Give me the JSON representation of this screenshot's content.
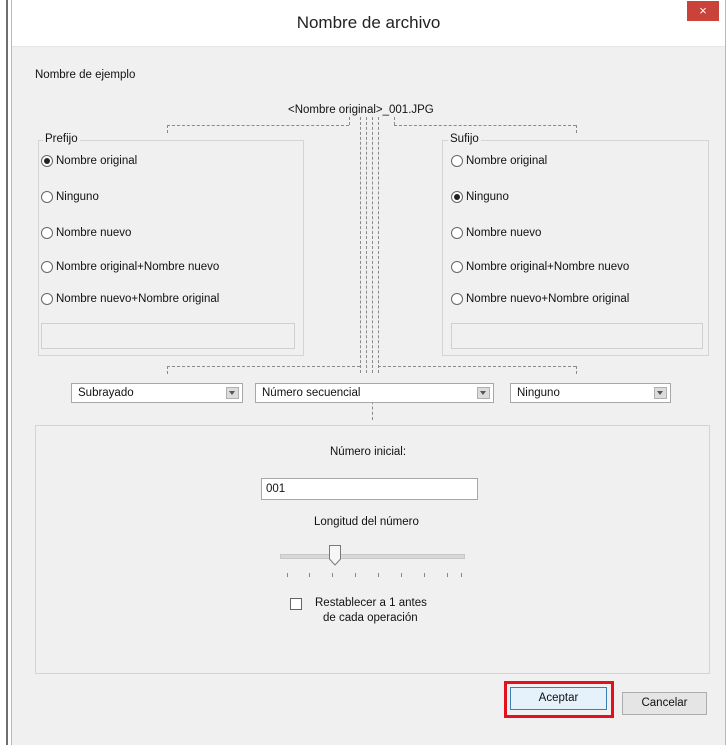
{
  "window": {
    "title": "Nombre de archivo",
    "close_label": "×"
  },
  "example": {
    "label": "Nombre de ejemplo",
    "value": "<Nombre original>_001.JPG"
  },
  "prefix": {
    "label": "Prefijo",
    "options": [
      "Nombre original",
      "Ninguno",
      "Nombre nuevo",
      "Nombre original+Nombre nuevo",
      "Nombre nuevo+Nombre original"
    ],
    "selected": "Nombre original"
  },
  "suffix": {
    "label": "Sufijo",
    "options": [
      "Nombre original",
      "Ninguno",
      "Nombre nuevo",
      "Nombre original+Nombre nuevo",
      "Nombre nuevo+Nombre original"
    ],
    "selected": "Ninguno"
  },
  "dropdowns": {
    "separator": "Subrayado",
    "middle": "Número secuencial",
    "end": "Ninguno"
  },
  "numbering": {
    "start_label": "Número inicial:",
    "start_value": "001",
    "length_label": "Longitud del número",
    "length_level_fraction": 0.3,
    "reset_label_line1": "Restablecer a 1 antes",
    "reset_label_line2": "de cada operación",
    "reset_checked": false
  },
  "buttons": {
    "ok": "Aceptar",
    "cancel": "Cancelar"
  },
  "colors": {
    "highlight": "#e3101e",
    "close": "#c9433a"
  },
  "icons": {
    "close": "close-icon",
    "dropdown": "chevron-down-icon"
  }
}
